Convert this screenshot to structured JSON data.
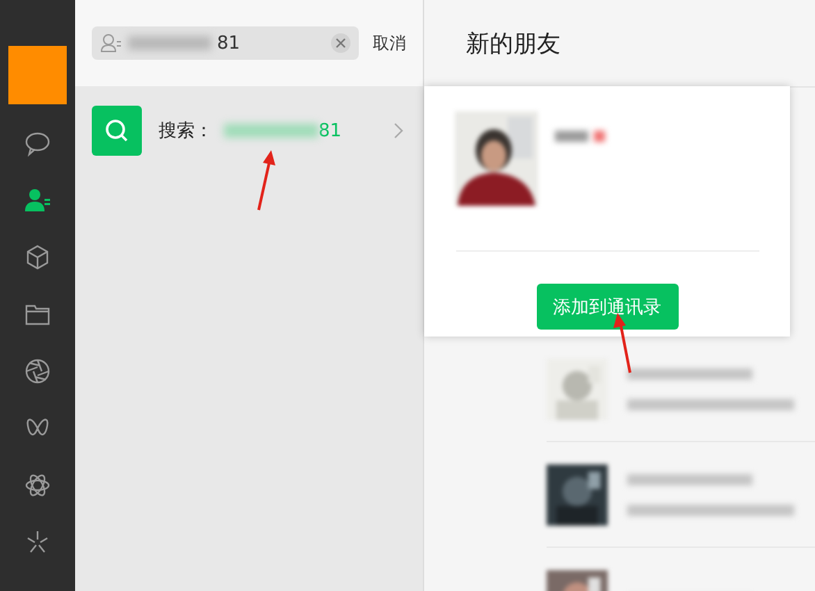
{
  "sidebar": {
    "items": [
      {
        "kind": "chat",
        "selected": false
      },
      {
        "kind": "contacts",
        "selected": true
      },
      {
        "kind": "box",
        "selected": false
      },
      {
        "kind": "folder",
        "selected": false
      },
      {
        "kind": "aperture",
        "selected": false
      },
      {
        "kind": "butterfly",
        "selected": false
      },
      {
        "kind": "atom",
        "selected": false
      },
      {
        "kind": "sparkle",
        "selected": false
      }
    ]
  },
  "search": {
    "value": "81",
    "cancel": "取消"
  },
  "result": {
    "label": "搜索：",
    "value": "81"
  },
  "header": {
    "title": "新的朋友"
  },
  "popup": {
    "button": "添加到通讯录"
  }
}
